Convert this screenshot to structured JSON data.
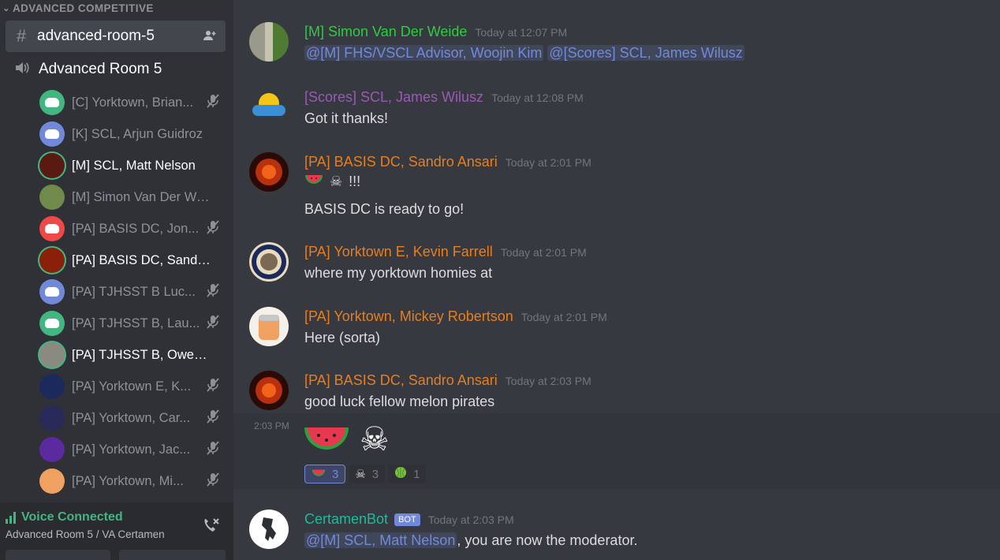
{
  "sidebar": {
    "category": "ADVANCED COMPETITIVE",
    "text_channel": "advanced-room-5",
    "voice_channel": "Advanced Room 5",
    "members": [
      {
        "name": "[C] Yorktown, Brian...",
        "active": false,
        "speaking": false,
        "muted": true,
        "avatar": "discord-green"
      },
      {
        "name": "[K] SCL, Arjun Guidroz",
        "active": false,
        "speaking": false,
        "muted": false,
        "avatar": "discord-blurple"
      },
      {
        "name": "[M] SCL, Matt Nelson",
        "active": true,
        "speaking": true,
        "muted": false,
        "avatar": "photo-dark-red"
      },
      {
        "name": "[M] Simon Van Der Wei...",
        "active": false,
        "speaking": false,
        "muted": false,
        "avatar": "photo-nature"
      },
      {
        "name": "[PA] BASIS DC, Jon...",
        "active": false,
        "speaking": false,
        "muted": true,
        "avatar": "discord-red"
      },
      {
        "name": "[PA] BASIS DC, Sandro ...",
        "active": true,
        "speaking": true,
        "muted": false,
        "avatar": "photo-fire"
      },
      {
        "name": "[PA] TJHSST B Luc...",
        "active": false,
        "speaking": false,
        "muted": true,
        "avatar": "discord-blurple"
      },
      {
        "name": "[PA] TJHSST B, Lau...",
        "active": false,
        "speaking": false,
        "muted": true,
        "avatar": "discord-green"
      },
      {
        "name": "[PA] TJHSST B, Owen G...",
        "active": true,
        "speaking": true,
        "muted": false,
        "avatar": "photo-statue"
      },
      {
        "name": "[PA] Yorktown E, K...",
        "active": false,
        "speaking": false,
        "muted": true,
        "avatar": "photo-seal"
      },
      {
        "name": "[PA] Yorktown, Car...",
        "active": false,
        "speaking": false,
        "muted": true,
        "avatar": "photo-night"
      },
      {
        "name": "[PA] Yorktown, Jac...",
        "active": false,
        "speaking": false,
        "muted": true,
        "avatar": "photo-purple"
      },
      {
        "name": "[PA] Yorktown, Mi...",
        "active": false,
        "speaking": false,
        "muted": true,
        "avatar": "photo-orange"
      }
    ],
    "voice_status": {
      "title": "Voice Connected",
      "subtitle": "Advanced Room 5 / VA Certamen"
    }
  },
  "messages": [
    {
      "author": "[M] Simon Van Der Weide",
      "color": "#2ecc40",
      "timestamp": "Today at 12:07 PM",
      "mentions": [
        "@[M] FHS/VSCL Advisor, Woojin Kim",
        "@[Scores] SCL, James Wilusz"
      ]
    },
    {
      "author": "[Scores] SCL, James Wilusz",
      "color": "#9b59b6",
      "timestamp": "Today at 12:08 PM",
      "text": "Got it thanks!"
    },
    {
      "author": "[PA] BASIS DC, Sandro Ansari",
      "color": "#e67e22",
      "timestamp": "Today at 2:01 PM",
      "line1": "!!!",
      "text": "BASIS DC is ready to go!"
    },
    {
      "author": "[PA] Yorktown E, Kevin Farrell",
      "color": "#e67e22",
      "timestamp": "Today at 2:01 PM",
      "text": "where my yorktown homies at"
    },
    {
      "author": "[PA] Yorktown, Mickey Robertson",
      "color": "#e67e22",
      "timestamp": "Today at 2:01 PM",
      "text": "Here (sorta)"
    },
    {
      "author": "[PA] BASIS DC, Sandro Ansari",
      "color": "#e67e22",
      "timestamp": "Today at 2:03 PM",
      "text": "good luck fellow melon pirates"
    },
    {
      "author": "CertamenBot",
      "color": "#1abc9c",
      "timestamp": "Today at 2:03 PM",
      "bot_tag": "BOT",
      "mention": "@[M] SCL, Matt Nelson",
      "text": ", you are now the moderator."
    }
  ],
  "followup": {
    "timestamp": "2:03 PM",
    "reactions": [
      {
        "emoji": "watermelon",
        "count": "3",
        "me": true
      },
      {
        "emoji": "skull-crossbones",
        "count": "3",
        "me": false
      },
      {
        "emoji": "melon",
        "count": "1",
        "me": false
      }
    ]
  }
}
